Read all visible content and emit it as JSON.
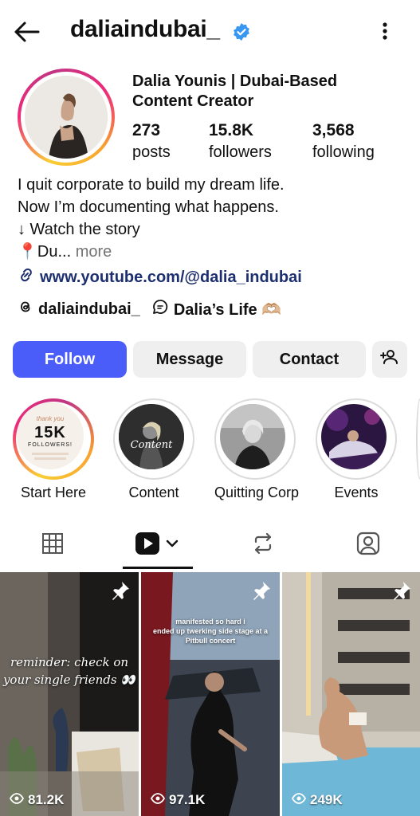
{
  "header": {
    "username": "daliaindubai_",
    "back_icon": "arrow-left-icon",
    "verified_icon": "verified-badge-icon",
    "more_icon": "more-vertical-icon"
  },
  "profile": {
    "full_name": "Dalia Younis | Dubai-Based Content Creator",
    "stats": [
      {
        "value": "273",
        "label": "posts"
      },
      {
        "value": "15.8K",
        "label": "followers"
      },
      {
        "value": "3,568",
        "label": "following"
      }
    ],
    "bio_lines": [
      "I quit corporate to build my dream life.",
      "Now I’m documenting what happens.",
      "↓ Watch the story"
    ],
    "bio_truncated": "📍Du...",
    "bio_more": "more",
    "link": "www.youtube.com/@dalia_indubai",
    "threads_handle": "daliaindubai_",
    "channel_name": "Dalia’s Life 🫶🏼"
  },
  "buttons": {
    "follow": "Follow",
    "message": "Message",
    "contact": "Contact"
  },
  "highlights": [
    {
      "label": "Start Here",
      "cover_title": "thank you",
      "cover_number": "15K",
      "cover_sub": "FOLLOWERS!"
    },
    {
      "label": "Content",
      "cover_text": "Content"
    },
    {
      "label": "Quitting Corp"
    },
    {
      "label": "Events"
    }
  ],
  "tabs": [
    "grid-icon",
    "reels-icon",
    "reposts-icon",
    "tagged-icon"
  ],
  "posts": [
    {
      "views": "81.2K",
      "caption_line1": "reminder: check on",
      "caption_line2": "your single friends 👀"
    },
    {
      "views": "97.1K",
      "caption_line1": "manifested so hard i",
      "caption_line2": "ended up twerking side stage at a",
      "caption_line3": "Pitbull concert"
    },
    {
      "views": "249K"
    }
  ],
  "colors": {
    "follow_button": "#4a5df9",
    "link": "#1d2f6f",
    "verified": "#3897f0",
    "secondary_button": "#efefef"
  }
}
